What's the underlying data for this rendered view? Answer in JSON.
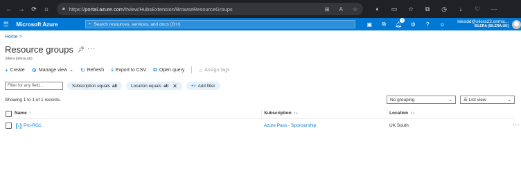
{
  "browser": {
    "url_prefix": "https://",
    "url_host": "portal.azure.com",
    "url_rest": "/#view/HubsExtension/BrowseResourceGroups"
  },
  "header": {
    "brand": "Microsoft Azure",
    "search_placeholder": "Search resources, services, and docs (G+/)",
    "notification_count": "1",
    "user_email": "leksidd@silera22.onmic...",
    "user_tenant": "SILERA (SILERA.UK)"
  },
  "breadcrumb": {
    "home": "Home",
    "separator": ">"
  },
  "page": {
    "title": "Resource groups",
    "subtitle": "Silera (silera.uk)"
  },
  "toolbar": {
    "create": "Create",
    "manage_view": "Manage view",
    "refresh": "Refresh",
    "export_csv": "Export to CSV",
    "open_query": "Open query",
    "assign_tags": "Assign tags"
  },
  "filters": {
    "placeholder": "Filter for any field...",
    "subscription_label": "Subscription equals",
    "subscription_value": "all",
    "location_label": "Location equals",
    "location_value": "all",
    "add_filter": "Add filter"
  },
  "summary": {
    "showing": "Showing 1 to 1 of 1 records.",
    "grouping": "No grouping",
    "view": "List view"
  },
  "table": {
    "columns": [
      "Name",
      "Subscription",
      "Location"
    ],
    "sort_glyph": "↑↓",
    "name_sort_glyph": "↑",
    "rows": [
      {
        "name": "Pro-RG1",
        "subscription": "Azure Pass - Sponsorship",
        "location": "UK South"
      }
    ]
  },
  "colors": {
    "accent": "#0078d4",
    "browser_bar": "#202124",
    "pill_bg": "#e5f1fb"
  }
}
